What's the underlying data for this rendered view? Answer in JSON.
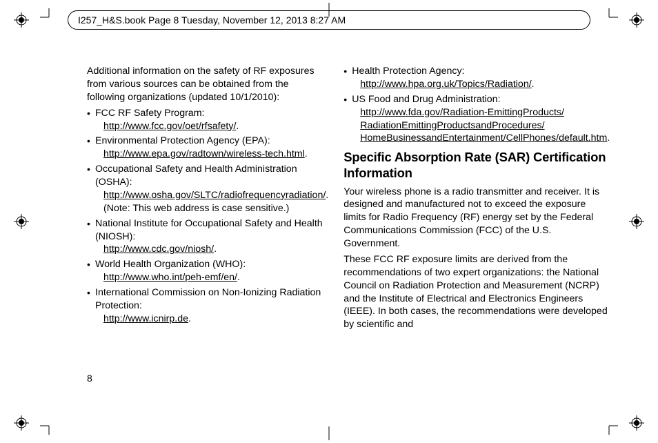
{
  "header": {
    "text": "I257_H&S.book  Page 8  Tuesday, November 12, 2013  8:27 AM"
  },
  "page_number": "8",
  "col1": {
    "intro": "Additional information on the safety of RF exposures from various sources can be obtained from the following organizations (updated 10/1/2010):",
    "items": [
      {
        "label": "FCC RF Safety Program:",
        "url": "http://www.fcc.gov/oet/rfsafety/",
        "tail": "."
      },
      {
        "label": "Environmental Protection Agency (EPA):",
        "url": "http://www.epa.gov/radtown/wireless-tech.html",
        "tail": "."
      },
      {
        "label": "Occupational Safety and Health Administration (OSHA):",
        "url": "http://www.osha.gov/SLTC/radiofrequencyradiation/",
        "tail": ". (Note: This web address is case sensitive.)"
      },
      {
        "label": "National Institute for Occupational Safety and Health (NIOSH):",
        "url": "http://www.cdc.gov/niosh/",
        "tail": "."
      },
      {
        "label": "World Health Organization (WHO):",
        "url": "http://www.who.int/peh-emf/en/",
        "tail": "."
      },
      {
        "label": "International Commission on Non-Ionizing Radiation Protection:",
        "url": "http://www.icnirp.de",
        "tail": "."
      }
    ]
  },
  "col2": {
    "items": [
      {
        "label": "Health Protection Agency:",
        "url": "http://www.hpa.org.uk/Topics/Radiation/",
        "tail": "."
      },
      {
        "label": "US Food and Drug Administration:",
        "url_lines": [
          "http://www.fda.gov/Radiation-EmittingProducts/",
          "RadiationEmittingProductsandProcedures/",
          "HomeBusinessandEntertainment/CellPhones/default.htm"
        ],
        "tail": "."
      }
    ],
    "heading": "Specific Absorption Rate (SAR) Certification Information",
    "p1": "Your wireless phone is a radio transmitter and receiver. It is designed and manufactured not to exceed the exposure limits for Radio Frequency (RF) energy set by the Federal Communications Commission (FCC) of the U.S. Government.",
    "p2": "These FCC RF exposure limits are derived from the recommendations of two expert organizations: the National Council on Radiation Protection and Measurement (NCRP) and the Institute of Electrical and Electronics Engineers (IEEE). In both cases, the recommendations were developed by scientific and"
  }
}
